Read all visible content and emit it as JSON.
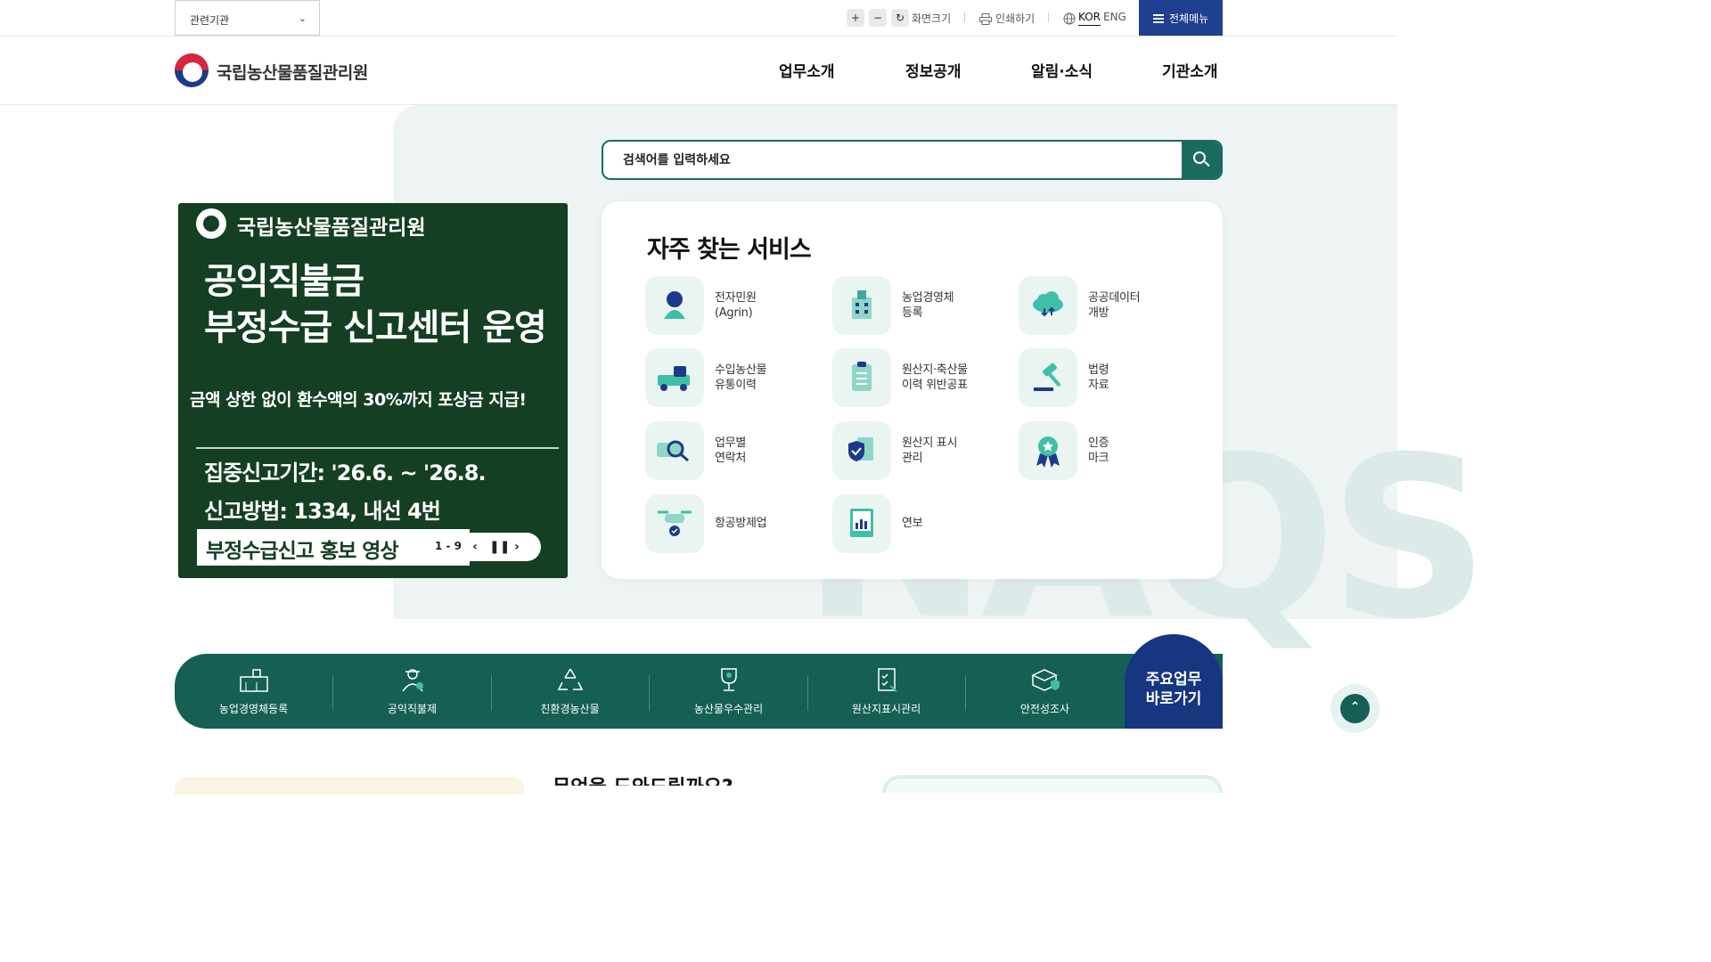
{
  "topbar": {
    "related_label": "관련기관",
    "zoom_in": "+",
    "zoom_out": "−",
    "zoom_reset": "↻",
    "zoom_label": "화면크기",
    "print_label": "인쇄하기",
    "lang_kor": "KOR",
    "lang_eng": "ENG",
    "all_menu": "전체메뉴"
  },
  "header": {
    "org_name": "국립농산물품질관리원",
    "nav": [
      "업무소개",
      "정보공개",
      "알림·소식",
      "기관소개"
    ]
  },
  "search": {
    "placeholder": "검색어를 입력하세요"
  },
  "banner": {
    "org": "국립농산물품질관리원",
    "title": "공익직불금\n부정수급 신고센터 운영",
    "subtitle": "금액 상한 없이 환수액의 30%까지 포상금 지급!",
    "period": "집중신고기간: '26.6. ~ '26.8.",
    "method": "신고방법: 1334, 내선 4번",
    "video": "부정수급신고 홍보 영상",
    "pager": "1 - 9"
  },
  "services": {
    "title": "자주 찾는 서비스",
    "items": [
      {
        "label": "전자민원\n(Agrin)",
        "icon": "person-icon"
      },
      {
        "label": "농업경영체\n등록",
        "icon": "building-icon"
      },
      {
        "label": "공공데이터\n개방",
        "icon": "cloud-icon"
      },
      {
        "label": "수입농산물\n유통이력",
        "icon": "truck-icon"
      },
      {
        "label": "원산지·축산물\n이력 위반공표",
        "icon": "clipboard-icon"
      },
      {
        "label": "법령\n자료",
        "icon": "gavel-icon"
      },
      {
        "label": "업무별\n연락처",
        "icon": "magnifier-icon"
      },
      {
        "label": "원산지 표시\n관리",
        "icon": "shield-doc-icon"
      },
      {
        "label": "인증\n마크",
        "icon": "award-icon"
      },
      {
        "label": "항공방제업",
        "icon": "drone-icon"
      },
      {
        "label": "연보",
        "icon": "chart-book-icon"
      }
    ]
  },
  "quick": {
    "items": [
      "농업경영체등록",
      "공익직불제",
      "친환경농산물",
      "농산물우수관리",
      "원산지표시관리",
      "안전성조사"
    ],
    "main": "주요업무\n바로가기"
  },
  "bottom_peek": "무엇을 도와드릴까요?",
  "colors": {
    "primary_green": "#155f54",
    "navy": "#173680",
    "banner_green": "#143f22"
  }
}
